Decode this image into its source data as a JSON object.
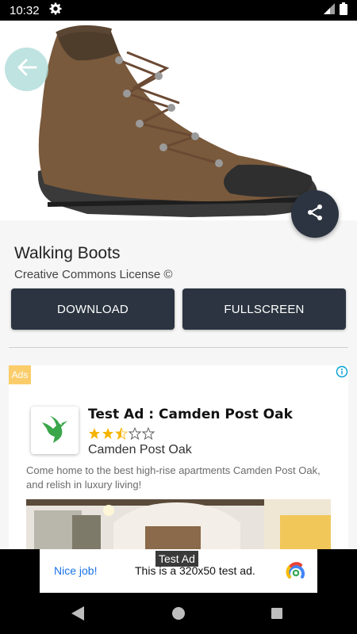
{
  "status_bar": {
    "time": "10:32",
    "settings_icon": "gear-icon",
    "signal_icon": "signal-icon",
    "battery_icon": "battery-icon"
  },
  "hero": {
    "image": "hiking-boot-photo",
    "back_icon": "arrow-left-icon",
    "share_icon": "share-icon"
  },
  "item": {
    "title": "Walking Boots",
    "license": "Creative Commons License ©"
  },
  "actions": {
    "download_label": "DOWNLOAD",
    "fullscreen_label": "FULLSCREEN"
  },
  "native_ad": {
    "badge": "Ads",
    "headline": "Test Ad : Camden Post Oak",
    "rating": 2.5,
    "rating_max": 5,
    "advertiser": "Camden Post Oak",
    "body": "Come home to the best high-rise apartments Camden Post Oak, and relish in luxury living!",
    "icon": "hummingbird-icon"
  },
  "banner_ad": {
    "label": "Test Ad",
    "nice": "Nice job!",
    "text": "This is a 320x50 test ad."
  },
  "colors": {
    "primary": "#2b3440",
    "accent_teal": "#a8dad5",
    "ads_badge": "#fbcd6a",
    "star": "#f5b400",
    "link_blue": "#1a73e8"
  }
}
